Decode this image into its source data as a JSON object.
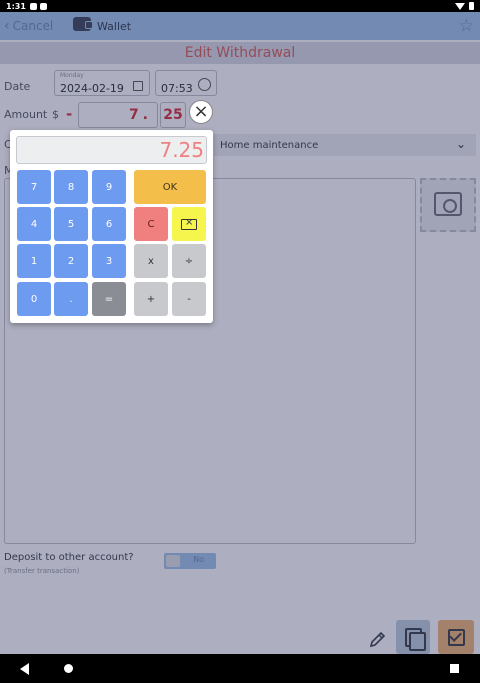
{
  "status_bar": {
    "time": "1:31"
  },
  "topbar": {
    "cancel_label": "Cancel",
    "title": "Wallet"
  },
  "headline": "Edit Withdrawal",
  "date_section": {
    "label": "Date",
    "weekday": "Monday",
    "date": "2024-02-19",
    "time": "07:53"
  },
  "amount_section": {
    "label": "Amount",
    "currency": "$",
    "sign": "-",
    "whole": "7.",
    "cents": "25"
  },
  "category": {
    "label": "C",
    "value": "Home maintenance"
  },
  "memo": {
    "label": "M"
  },
  "deposit": {
    "question": "Deposit to other account?",
    "subtitle": "(Transfer transaction)",
    "toggle_text": "No"
  },
  "calculator": {
    "display": "7.25",
    "rows": [
      [
        "7",
        "8",
        "9"
      ],
      [
        "4",
        "5",
        "6"
      ],
      [
        "1",
        "2",
        "3"
      ],
      [
        "0",
        ".",
        "="
      ]
    ],
    "ok_label": "OK",
    "clear_label": "C",
    "mult_label": "x",
    "div_label": "÷",
    "plus_label": "+",
    "minus_label": "-"
  },
  "colors": {
    "topbar": "#9bbfe6",
    "number_key": "#6d9bf0",
    "ok_key": "#f4be4a",
    "clear_key": "#f07f7f",
    "backspace_key": "#f5f54e",
    "operator_key": "#c8c9cc",
    "amount_text": "#d03040",
    "save_button": "#e7b07a"
  }
}
